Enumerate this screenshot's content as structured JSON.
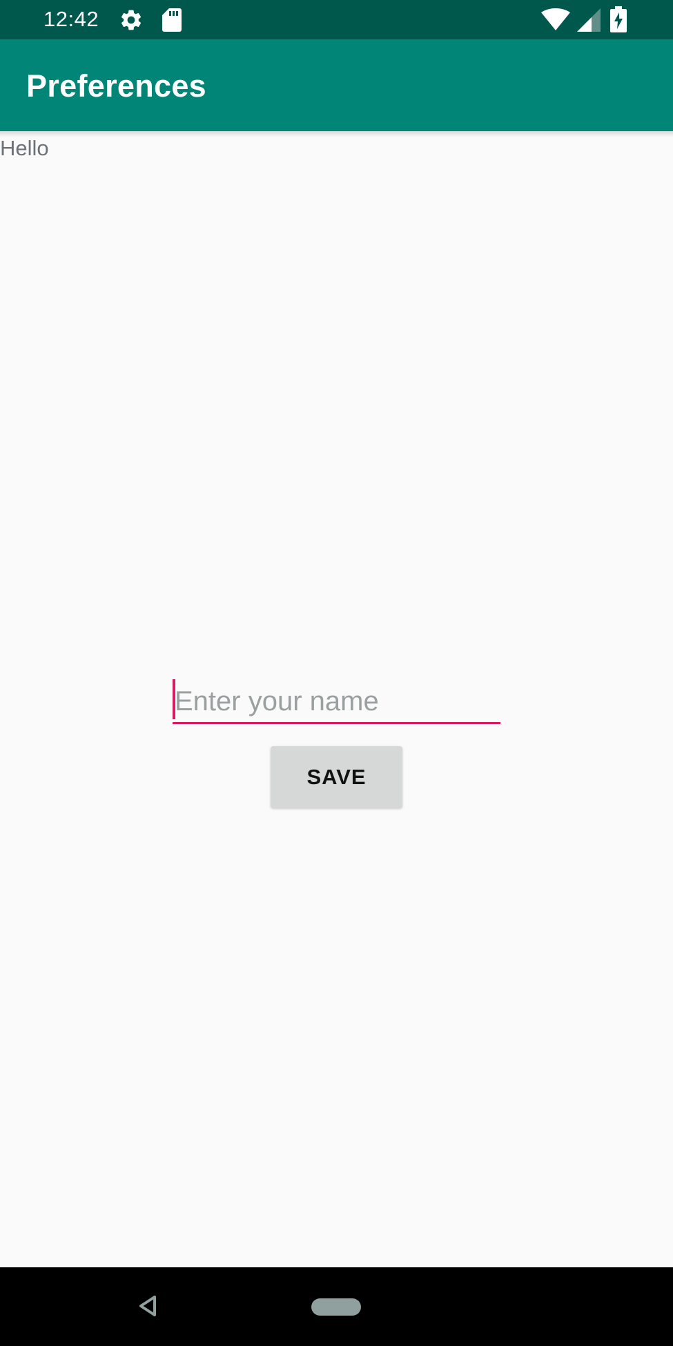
{
  "status_bar": {
    "time": "12:42",
    "left_icons": [
      "gear-icon",
      "sd-card-icon"
    ],
    "right_icons": [
      "wifi-icon",
      "cell-signal-icon",
      "battery-charging-icon"
    ],
    "background_color": "#00574b"
  },
  "app_bar": {
    "title": "Preferences",
    "background_color": "#008577"
  },
  "content": {
    "greeting": "Hello",
    "name_input": {
      "placeholder": "Enter your name",
      "value": "",
      "accent_color": "#d81b60"
    },
    "save_button": {
      "label": "SAVE"
    }
  },
  "nav_bar": {
    "icons": [
      "back-icon",
      "home-pill-icon"
    ]
  }
}
